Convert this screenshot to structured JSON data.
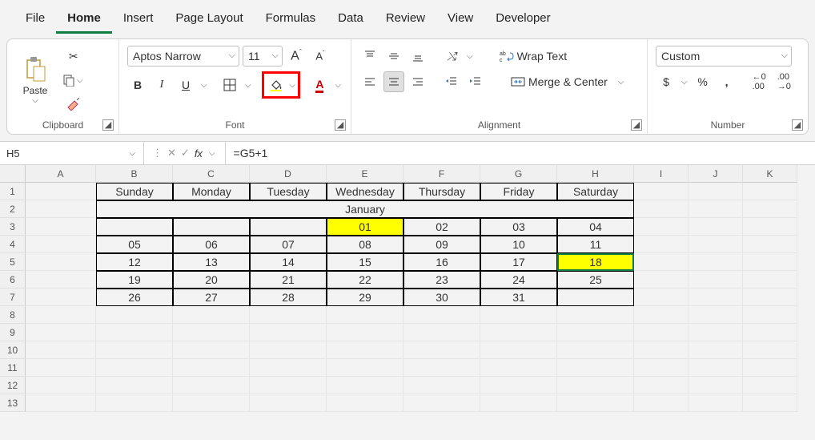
{
  "tabs": [
    "File",
    "Home",
    "Insert",
    "Page Layout",
    "Formulas",
    "Data",
    "Review",
    "View",
    "Developer"
  ],
  "active_tab": 1,
  "ribbon": {
    "clipboard": {
      "label": "Clipboard",
      "paste": "Paste"
    },
    "font": {
      "label": "Font",
      "font_name": "Aptos Narrow",
      "font_size": "11",
      "bold": "B",
      "italic": "I",
      "underline": "U"
    },
    "alignment": {
      "label": "Alignment",
      "wrap": "Wrap Text",
      "merge": "Merge & Center"
    },
    "number": {
      "label": "Number",
      "format": "Custom",
      "currency": "$",
      "percent": "%",
      "comma": ","
    }
  },
  "namebox": "H5",
  "formula": "=G5+1",
  "columns": [
    "A",
    "B",
    "C",
    "D",
    "E",
    "F",
    "G",
    "H",
    "I",
    "J",
    "K"
  ],
  "rows": [
    "1",
    "2",
    "3",
    "4",
    "5",
    "6",
    "7",
    "8",
    "9",
    "10",
    "11",
    "12",
    "13"
  ],
  "colors": {
    "highlight": "#FFFF00",
    "accent": "#107c41",
    "red": "#FF0000"
  },
  "highlighted_fill_button": true,
  "selected_cell": "H5",
  "chart_data": {
    "type": "table",
    "title": "January",
    "headers": [
      "Sunday",
      "Monday",
      "Tuesday",
      "Wednesday",
      "Thursday",
      "Friday",
      "Saturday"
    ],
    "rows": [
      [
        "",
        "",
        "",
        "01",
        "02",
        "03",
        "04"
      ],
      [
        "05",
        "06",
        "07",
        "08",
        "09",
        "10",
        "11"
      ],
      [
        "12",
        "13",
        "14",
        "15",
        "16",
        "17",
        "18"
      ],
      [
        "19",
        "20",
        "21",
        "22",
        "23",
        "24",
        "25"
      ],
      [
        "26",
        "27",
        "28",
        "29",
        "30",
        "31",
        ""
      ]
    ],
    "highlighted_cells": [
      [
        0,
        3
      ],
      [
        2,
        6
      ]
    ]
  }
}
